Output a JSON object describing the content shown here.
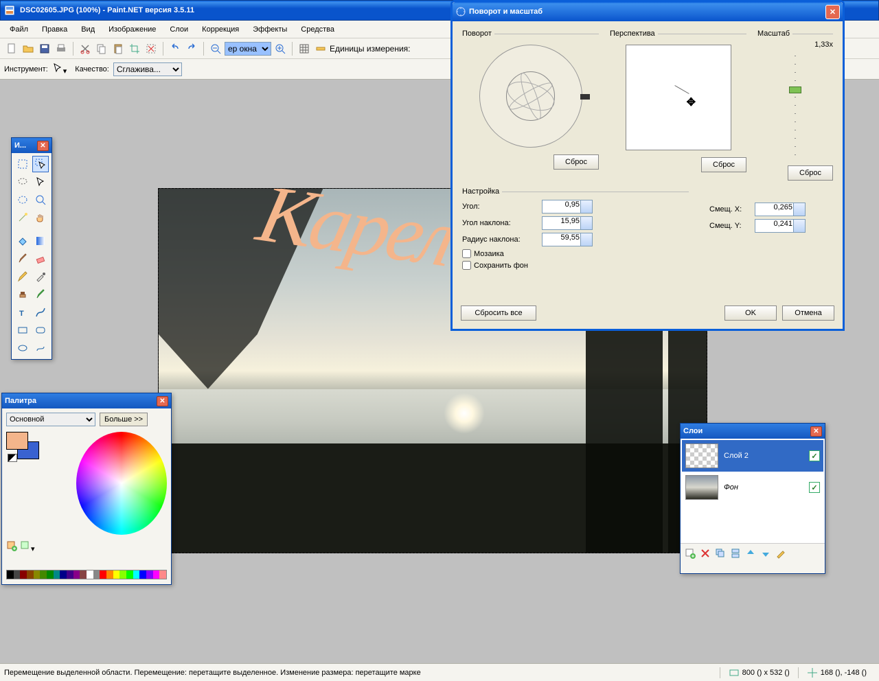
{
  "titlebar": {
    "text": "DSC02605.JPG (100%) - Paint.NET версия 3.5.11"
  },
  "menu": {
    "file": "Файл",
    "edit": "Правка",
    "view": "Вид",
    "image": "Изображение",
    "layers": "Слои",
    "correction": "Коррекция",
    "effects": "Эффекты",
    "tools": "Средства"
  },
  "toolbar": {
    "zoom_value": "ер окна",
    "units_label": "Единицы измерения:"
  },
  "tooloptbar": {
    "tool_label": "Инструмент:",
    "quality_label": "Качество:",
    "quality_value": "Сглажива..."
  },
  "overlay": {
    "text": "Карелия"
  },
  "statusbar": {
    "hint": "Перемещение выделенной области. Перемещение: перетащите выделенное. Изменение размера: перетащите марке",
    "size": "800 () x 532 ()",
    "pos": "168 (), -148 ()"
  },
  "tools_win": {
    "title": "И..."
  },
  "colors_win": {
    "title": "Палитра",
    "mode": "Основной",
    "more": "Больше >>"
  },
  "layers_win": {
    "title": "Слои",
    "layer2": "Слой 2",
    "bg": "Фон"
  },
  "dialog": {
    "title": "Поворот и масштаб",
    "sec_rot": "Поворот",
    "sec_persp": "Перспектива",
    "sec_scale": "Масштаб",
    "scale_val": "1,33x",
    "reset": "Сброс",
    "settings": "Настройка",
    "angle_lbl": "Угол:",
    "angle": "0,95",
    "tilt_lbl": "Угол наклона:",
    "tilt": "15,95",
    "radius_lbl": "Радиус наклона:",
    "radius": "59,55",
    "offx_lbl": "Смещ. X:",
    "offx": "0,265",
    "offy_lbl": "Смещ. Y:",
    "offy": "0,241",
    "tile": "Мозаика",
    "keepbg": "Сохранить фон",
    "reset_all": "Сбросить все",
    "ok": "OK",
    "cancel": "Отмена"
  },
  "palette_colors": [
    "#000",
    "#444",
    "#800",
    "#840",
    "#880",
    "#480",
    "#080",
    "#088",
    "#008",
    "#408",
    "#808",
    "#844",
    "#fff",
    "#888",
    "#f00",
    "#f80",
    "#ff0",
    "#8f0",
    "#0f0",
    "#0ff",
    "#00f",
    "#80f",
    "#f0f",
    "#f88"
  ]
}
